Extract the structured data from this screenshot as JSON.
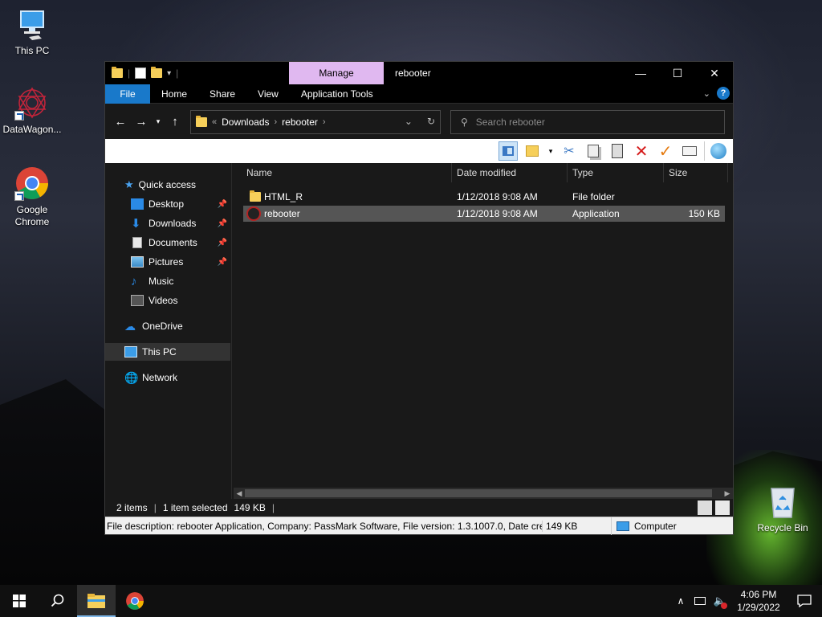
{
  "desktop": {
    "icons": [
      {
        "label": "This PC"
      },
      {
        "label": "DataWagon..."
      },
      {
        "label": "Google Chrome"
      },
      {
        "label": "Recycle Bin"
      }
    ]
  },
  "window": {
    "qat_separator": "|",
    "context_tab": "Manage",
    "title": "rebooter",
    "controls": {
      "minimize": "—",
      "maximize": "☐",
      "close": "✕"
    },
    "ribbon_tabs": [
      "File",
      "Home",
      "Share",
      "View",
      "Application Tools"
    ],
    "help_label": "?",
    "address": {
      "overflow": "«",
      "crumbs": [
        "Downloads",
        "rebooter"
      ],
      "separator": "›"
    },
    "search": {
      "placeholder": "Search rebooter"
    },
    "nav": {
      "quick_access": "Quick access",
      "items": [
        "Desktop",
        "Downloads",
        "Documents",
        "Pictures",
        "Music",
        "Videos"
      ],
      "onedrive": "OneDrive",
      "this_pc": "This PC",
      "network": "Network"
    },
    "columns": [
      "Name",
      "Date modified",
      "Type",
      "Size"
    ],
    "files": [
      {
        "name": "HTML_R",
        "date": "1/12/2018 9:08 AM",
        "type": "File folder",
        "size": ""
      },
      {
        "name": "rebooter",
        "date": "1/12/2018 9:08 AM",
        "type": "Application",
        "size": "150 KB"
      }
    ],
    "status": {
      "items": "2 items",
      "selected": "1 item selected",
      "selected_size": "149 KB",
      "separator": "|"
    },
    "infobar": {
      "description": "File description: rebooter Application, Company: PassMark Software, File version: 1.3.1007.0, Date create",
      "size": "149 KB",
      "location": "Computer"
    }
  },
  "taskbar": {
    "time": "4:06 PM",
    "date": "1/29/2022"
  },
  "colors": {
    "accent": "#1979ca",
    "manage_tab": "#e0b8f0",
    "folder": "#f6cf5a"
  }
}
